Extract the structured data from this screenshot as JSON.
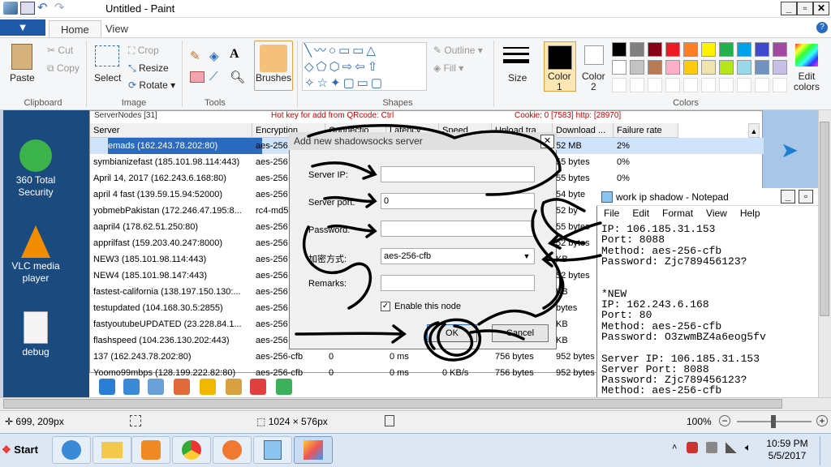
{
  "window": {
    "title": "Untitled - Paint"
  },
  "ribbon_tabs": {
    "file": "▼",
    "home": "Home",
    "view": "View"
  },
  "ribbon": {
    "paste": "Paste",
    "cut": "Cut",
    "copy": "Copy",
    "select": "Select",
    "crop": "Crop",
    "resize": "Resize",
    "rotate": "Rotate",
    "brushes": "Brushes",
    "outline": "Outline",
    "fill": "Fill",
    "size": "Size",
    "color1": "Color\n1",
    "color2": "Color\n2",
    "edit_colors": "Edit\ncolors",
    "groups": [
      "Clipboard",
      "Image",
      "Tools",
      "Shapes",
      "Colors"
    ]
  },
  "colors": {
    "accent": "#1e5aa8",
    "brush_bg": "#f9c87a",
    "palette": [
      "#000000",
      "#7f7f7f",
      "#880015",
      "#ed1c24",
      "#ff7f27",
      "#fff200",
      "#22b14c",
      "#00a2e8",
      "#3f48cc",
      "#a349a4",
      "#ffffff",
      "#c3c3c3",
      "#b97a57",
      "#ffaec9",
      "#ffc90e",
      "#efe4b0",
      "#b5e61d",
      "#99d9ea",
      "#7092be",
      "#c8bfe7"
    ]
  },
  "desktop_icons": [
    {
      "label": "360 Total\nSecurity",
      "icon": "360-security-icon"
    },
    {
      "label": "VLC media\nplayer",
      "icon": "vlc-icon"
    },
    {
      "label": "debug",
      "icon": "file-icon"
    }
  ],
  "server_list": {
    "top_text": "ServerNodes [31]",
    "top_hotkey": "Hot key for add from QRcode: Ctrl",
    "top_cookie": "Cookie: 0 [7583] http: [28970]",
    "columns": [
      "Server",
      "Encryption",
      "Connectio",
      "Latency",
      "Speed",
      "Upload tra",
      "Download ...",
      "Failure rate"
    ],
    "rows": [
      {
        "server": "emads (162.243.78.202:80)",
        "enc": "aes-256",
        "dl": "52 MB",
        "fail": "2%"
      },
      {
        "server": "symbianizefast (185.101.98.114:443)",
        "enc": "aes-256",
        "dl": "55 bytes",
        "fail": "0%"
      },
      {
        "server": "April 14, 2017 (162.243.6.168:80)",
        "enc": "aes-256",
        "dl": "55 bytes",
        "fail": "0%"
      },
      {
        "server": "april 4 fast (139.59.15.94:52000)",
        "enc": "aes-256",
        "dl": "54 byte",
        "fail": ""
      },
      {
        "server": "yobmebPakistan (172.246.47.195:8...",
        "enc": "rc4-md5",
        "dl": "52 by",
        "fail": ""
      },
      {
        "server": "aapril4 (178.62.51.250:80)",
        "enc": "aes-256",
        "dl": "55 bytes",
        "fail": ""
      },
      {
        "server": "apprilfast (159.203.40.247:8000)",
        "enc": "aes-256",
        "dl": "52 bytes",
        "fail": ""
      },
      {
        "server": "NEW3 (185.101.98.114:443)",
        "enc": "aes-256",
        "dl": "KB",
        "fail": ""
      },
      {
        "server": "NEW4 (185.101.98.147:443)",
        "enc": "aes-256",
        "dl": "52 bytes",
        "fail": ""
      },
      {
        "server": "fastest-california (138.197.150.130:...",
        "enc": "aes-256",
        "dl": "KB",
        "fail": ""
      },
      {
        "server": "testupdated (104.168.30.5:2855)",
        "enc": "aes-256",
        "dl": "bytes",
        "fail": ""
      },
      {
        "server": "fastyoutubeUPDATED (23.228.84.1...",
        "enc": "aes-256",
        "dl": "KB",
        "fail": ""
      },
      {
        "server": "flashspeed (104.236.130.202:443)",
        "enc": "aes-256",
        "dl": "KB",
        "fail": ""
      },
      {
        "server": "137 (162.243.78.202:80)",
        "enc": "aes-256-cfb",
        "conn": "0",
        "lat": "0 ms",
        "up": "756 bytes",
        "dl": "952 bytes",
        "fail": ""
      },
      {
        "server": "Yoomo99mbps (128.199.222.82:80)",
        "enc": "aes-256-cfb",
        "conn": "0",
        "lat": "0 ms",
        "speed": "0 KB/s",
        "up": "756 bytes",
        "dl": "952 bytes",
        "fail": ""
      }
    ]
  },
  "dialog": {
    "title": "Add new shadowsocks server",
    "server_ip_label": "Server IP:",
    "server_ip": "",
    "server_port_label": "Server port:",
    "server_port": "0",
    "password_label": "Password:",
    "password": "",
    "method_label": "加密方式:",
    "method": "aes-256-cfb",
    "remarks_label": "Remarks:",
    "remarks": "",
    "enable_label": "Enable this node",
    "ok": "OK",
    "cancel": "Cancel",
    "close": "✕"
  },
  "notepad": {
    "title": "work ip shadow - Notepad",
    "menu": [
      "File",
      "Edit",
      "Format",
      "View",
      "Help"
    ],
    "text": "IP: 106.185.31.153\nPort: 8088\nMethod: aes-256-cfb\nPassword: Zjc789456123?\n\n\n*NEW\nIP: 162.243.6.168\nPort: 80\nMethod: aes-256-cfb\nPassword: O3zwmBZ4a6eog5fv\n\nServer IP: 106.185.31.153\nServer Port: 8088\nPassword: Zjc789456123?\nMethod: aes-256-cfb"
  },
  "status_bar": {
    "cursor_pos": "699, 209px",
    "image_size": "1024 × 576px",
    "zoom": "100%"
  },
  "taskbar": {
    "start": "Start",
    "time": "10:59 PM",
    "date": "5/5/2017"
  }
}
